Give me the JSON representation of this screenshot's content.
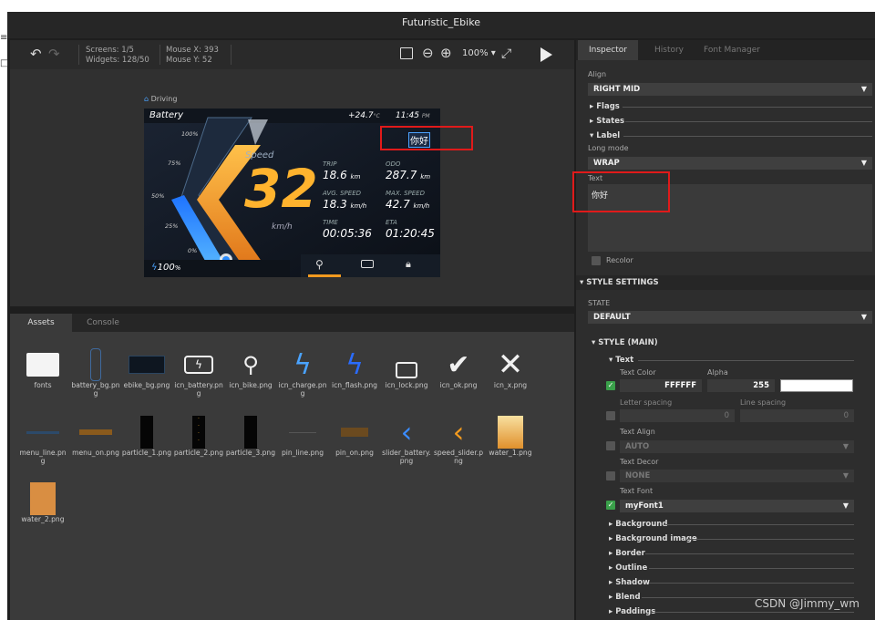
{
  "window": {
    "title": "Futuristic_Ebike"
  },
  "toolbar": {
    "screens": "Screens: 1/5",
    "widgets": "Widgets: 128/50",
    "mouse_x": "Mouse X: 393",
    "mouse_y": "Mouse Y: 52",
    "zoom": "100%"
  },
  "preview": {
    "screen_name": "Driving",
    "battery_label": "Battery",
    "temperature": "+24.7",
    "temp_unit": "°C",
    "time": "11:45",
    "ampm": "PM",
    "selected_label": "你好",
    "ticks": [
      "100%",
      "75%",
      "50%",
      "25%",
      "0%"
    ],
    "speed_label": "Speed",
    "speed": "32",
    "speed_unit": "km/h",
    "trip_label": "TRIP",
    "trip": "18.6",
    "trip_unit": "km",
    "odo_label": "ODO",
    "odo": "287.7",
    "odo_unit": "km",
    "avg_label": "AVG. SPEED",
    "avg": "18.3",
    "avg_unit": "km/h",
    "max_label": "MAX. SPEED",
    "max": "42.7",
    "max_unit": "km/h",
    "time_label": "TIME",
    "time_val": "00:05:36",
    "eta_label": "ETA",
    "eta": "01:20:45",
    "battery_pct": "100",
    "battery_unit": "%"
  },
  "bottom_tabs": [
    "Assets",
    "Console"
  ],
  "assets": [
    {
      "name": "fonts",
      "icon": "folder-icon"
    },
    {
      "name": "battery_bg.png",
      "icon": "battery-bg-icon"
    },
    {
      "name": "ebike_bg.png",
      "icon": "ebike-bg-icon"
    },
    {
      "name": "icn_battery.png",
      "icon": "battery-charge-icon"
    },
    {
      "name": "icn_bike.png",
      "icon": "bike-icon"
    },
    {
      "name": "icn_charge.png",
      "icon": "charge-icon"
    },
    {
      "name": "icn_flash.png",
      "icon": "flash-icon"
    },
    {
      "name": "icn_lock.png",
      "icon": "lock-icon"
    },
    {
      "name": "icn_ok.png",
      "icon": "check-icon"
    },
    {
      "name": "icn_x.png",
      "icon": "x-icon"
    },
    {
      "name": "menu_line.png",
      "icon": "menu-line-icon"
    },
    {
      "name": "menu_on.png",
      "icon": "menu-on-icon"
    },
    {
      "name": "particle_1.png",
      "icon": "particle-icon"
    },
    {
      "name": "particle_2.png",
      "icon": "particle-icon"
    },
    {
      "name": "particle_3.png",
      "icon": "particle-icon"
    },
    {
      "name": "pin_line.png",
      "icon": "pin-line-icon"
    },
    {
      "name": "pin_on.png",
      "icon": "pin-on-icon"
    },
    {
      "name": "slider_battery.png",
      "icon": "slider-battery-icon"
    },
    {
      "name": "speed_slider.png",
      "icon": "speed-slider-icon"
    },
    {
      "name": "water_1.png",
      "icon": "water-icon"
    },
    {
      "name": "water_2.png",
      "icon": "water-icon"
    }
  ],
  "inspector": {
    "tabs": [
      "Inspector",
      "History",
      "Font Manager"
    ],
    "align_label": "Align",
    "align_value": "RIGHT MID",
    "flags": "Flags",
    "states": "States",
    "label_section": "Label",
    "long_mode_label": "Long mode",
    "long_mode_value": "WRAP",
    "text_label": "Text",
    "text_value": "你好",
    "recolor": "Recolor",
    "style_settings": "STYLE SETTINGS",
    "state_label": "STATE",
    "state_value": "DEFAULT",
    "style_main": "STYLE (MAIN)",
    "text_section": "Text",
    "text_color_label": "Text Color",
    "text_color_value": "FFFFFF",
    "alpha_label": "Alpha",
    "alpha_value": "255",
    "letter_spacing_label": "Letter spacing",
    "letter_spacing_value": "0",
    "line_spacing_label": "Line spacing",
    "line_spacing_value": "0",
    "text_align_label": "Text Align",
    "text_align_value": "AUTO",
    "text_decor_label": "Text Decor",
    "text_decor_value": "NONE",
    "text_font_label": "Text Font",
    "text_font_value": "myFont1",
    "sections": [
      "Background",
      "Background image",
      "Border",
      "Outline",
      "Shadow",
      "Blend",
      "Paddings"
    ]
  },
  "watermark": "CSDN @Jimmy_wm",
  "colors": {
    "accent_orange": "#f29a1f",
    "accent_blue": "#2a8cff",
    "selection_red": "#e01a1a",
    "check_green": "#3aa04a"
  }
}
